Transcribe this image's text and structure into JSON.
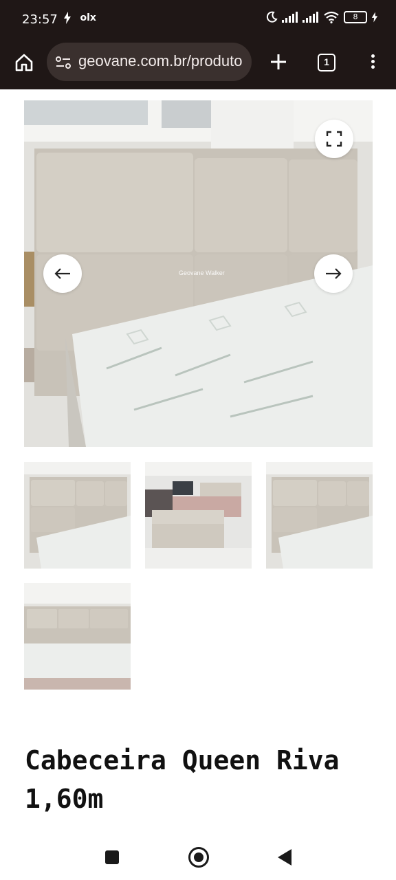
{
  "status_bar": {
    "time": "23:57",
    "left_icons": [
      "charging-bolt-icon",
      "olx-notification-icon"
    ],
    "olx_label": "olx",
    "battery_level": "8",
    "right_icons": [
      "moon-icon",
      "signal-icon",
      "signal-icon",
      "wifi-icon",
      "battery-icon",
      "charging-bolt-icon"
    ]
  },
  "browser": {
    "url": "geovane.com.br/produto",
    "tab_count": "1"
  },
  "gallery": {
    "watermark": "Geovane Walker",
    "thumbnails": 4
  },
  "product": {
    "title": "Cabeceira Queen Riva 1,60m"
  },
  "colors": {
    "chrome_dark": "#1f1716",
    "url_pill": "#3a302e",
    "headboard_fabric": "#cfcac1",
    "mattress": "#eef0ee"
  }
}
